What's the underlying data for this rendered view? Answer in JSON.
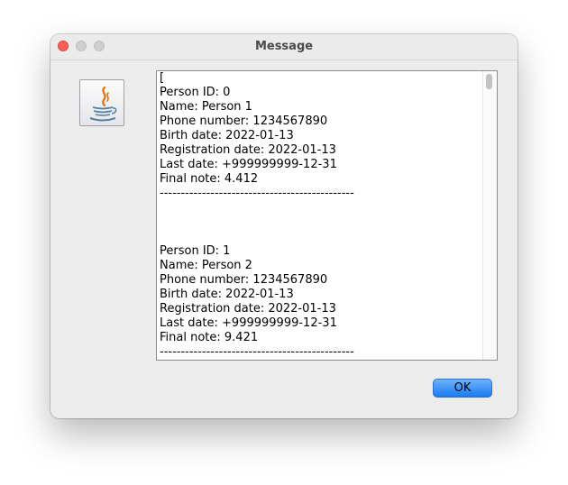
{
  "window": {
    "title": "Message"
  },
  "message": {
    "text": "[\nPerson ID: 0\nName: Person 1\nPhone number: 1234567890\nBirth date: 2022-01-13\nRegistration date: 2022-01-13\nLast date: +999999999-12-31\nFinal note: 4.412\n----------------------------------------------\n\n\n\nPerson ID: 1\nName: Person 2\nPhone number: 1234567890\nBirth date: 2022-01-13\nRegistration date: 2022-01-13\nLast date: +999999999-12-31\nFinal note: 9.421\n----------------------------------------------"
  },
  "buttons": {
    "ok_label": "OK"
  },
  "icons": {
    "app": "java-coffee-cup-icon",
    "close": "close-icon",
    "minimize": "minimize-icon",
    "maximize": "maximize-icon"
  },
  "colors": {
    "close_button": "#ff5f57",
    "ok_button": "#1a7bf2",
    "java_orange": "#e76f00",
    "java_blue": "#5382a1"
  }
}
